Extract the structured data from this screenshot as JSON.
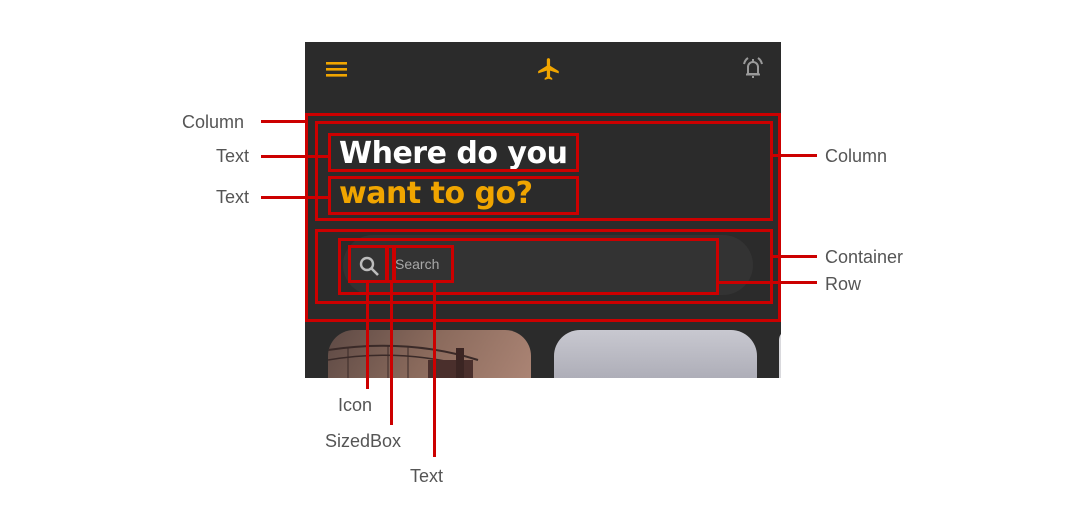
{
  "app": {
    "headline_line1": "Where do you",
    "headline_line2": "want to go?",
    "search_placeholder": "Search",
    "icons": [
      "menu-icon",
      "airplane-icon",
      "alarm-icon",
      "search-icon"
    ],
    "colors": {
      "background": "#2b2b2b",
      "accent": "#f0a500",
      "headline": "#ffffff",
      "annotation": "#cc0000"
    }
  },
  "annotations": {
    "left": [
      "Column",
      "Text",
      "Text"
    ],
    "right": [
      "Column",
      "Container",
      "Row"
    ],
    "bottom": [
      "Icon",
      "SizedBox",
      "Text"
    ]
  }
}
